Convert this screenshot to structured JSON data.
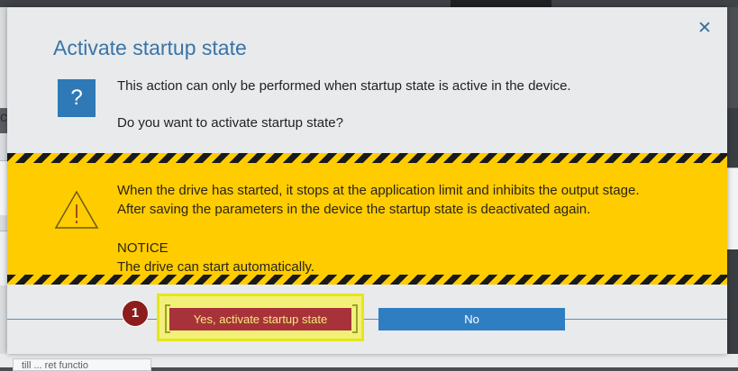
{
  "dialog": {
    "title": "Activate startup state",
    "close_icon": "close-icon",
    "question_icon": "?",
    "message_line1": "This action can only be performed when startup state is active in the device.",
    "message_line2": "Do you want to activate startup state?"
  },
  "warning": {
    "icon": "warning-triangle-icon",
    "line1": "When the drive has started, it stops at the application limit and inhibits the output stage.",
    "line2": "After saving the parameters in the device the startup state is deactivated again.",
    "notice_heading": "NOTICE",
    "notice_text": "The drive can start automatically."
  },
  "buttons": {
    "yes_label": "Yes, activate startup state",
    "no_label": "No"
  },
  "annotation": {
    "step_number": "1"
  },
  "background": {
    "left_char": "c",
    "bottom_text": "till ... ret functio"
  },
  "colors": {
    "title": "#3a74a8",
    "warning_bg": "#ffcc00",
    "yes_button": "#a8323a",
    "yes_text": "#f4ea7a",
    "no_button": "#2f7ec2",
    "highlight": "#f3f07a",
    "badge": "#8d1c1c"
  }
}
